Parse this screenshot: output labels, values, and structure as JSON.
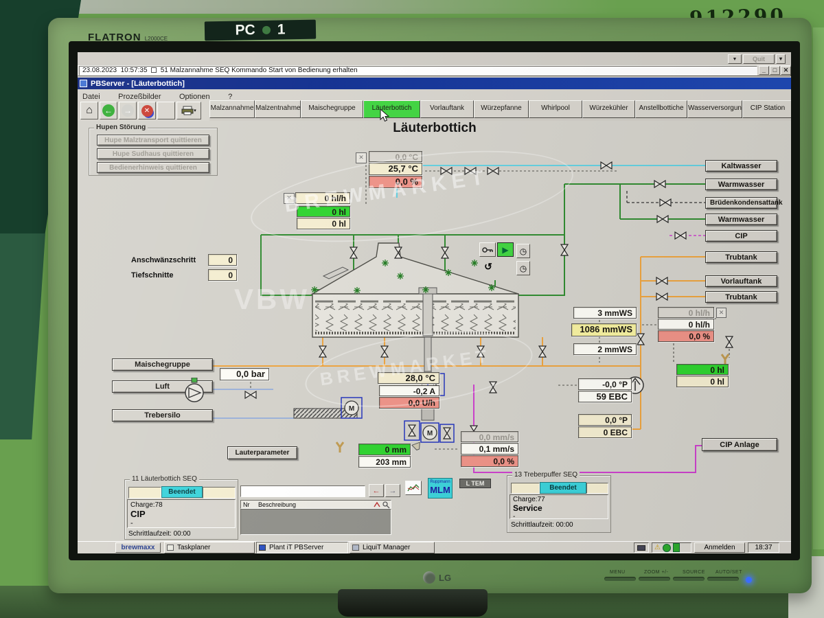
{
  "colors": {
    "active_tab_green": "#3fd43f",
    "status_cyan": "#3ad2da",
    "value_cream": "#f4edd0",
    "value_red": "#ee9287",
    "value_green": "#2ed32e",
    "value_yellow": "#f6f1a0",
    "titlebar_blue": "#0a2a8c",
    "pipe_green": "#2e8a2e",
    "pipe_orange": "#eda33d",
    "pipe_cyan": "#62cfe0",
    "pipe_magenta": "#cc3fcc"
  },
  "icons": {
    "down_arrow": "▼",
    "dropdown": "▾",
    "minimize": "_",
    "restore": "□",
    "close": "✕",
    "home": "⌂",
    "back": "←",
    "forward": "→",
    "play": "▶",
    "timer": "◷",
    "reset": "↺",
    "warning": "⚠",
    "arrow_left": "←",
    "arrow_right": "→",
    "motor": "M"
  },
  "photo": {
    "wall_number": "912290",
    "monitor_brand": "FLATRON",
    "monitor_model": "L2000CE",
    "sticker_pc": "PC",
    "sticker_no": "1",
    "lg_logo": "LG",
    "bezel_buttons": [
      "MENU",
      "ZOOM +/-",
      "SOURCE",
      "AUTO/SET"
    ]
  },
  "screen": {
    "quit_label": "Quit",
    "alarm": {
      "date": "23.08.2023",
      "time": "10:57:35",
      "message": "51 Malzannahme SEQ   Kommando Start von Bedienung erhalten"
    },
    "window_title": "PBServer - [Läuterbottich]",
    "menu": [
      "Datei",
      "Prozeßbilder",
      "Optionen",
      "?"
    ],
    "tabs": [
      {
        "label": "Malzannahme"
      },
      {
        "label": "Malzentnahme"
      },
      {
        "label": "Maischegruppe"
      },
      {
        "label": "Läuterbottich",
        "active": true
      },
      {
        "label": "Vorlauftank"
      },
      {
        "label": "Würzepfanne"
      },
      {
        "label": "Whirlpool"
      },
      {
        "label": "Würzekühler"
      },
      {
        "label": "Anstellbottiche"
      },
      {
        "label": "Wasserversorgung"
      },
      {
        "label": "CIP Station"
      }
    ],
    "canvas": {
      "title": "Läuterbottich",
      "hupen": {
        "title": "Hupen Störung",
        "buttons": [
          "Hupe Malztransport quittieren",
          "Hupe Sudhaus quittieren",
          "Bedienerhinweis quittieren"
        ]
      },
      "values": {
        "top_temp_alt": "0,0 °C",
        "top_temp": "25,7 °C",
        "top_pct": "0,0 %",
        "in_flow": "0 hl/h",
        "in_vol_set": "0 hl",
        "in_vol": "0 hl",
        "anschwaenz_label": "Anschwänzschritt",
        "anschwaenz": "0",
        "tiefschnitte_label": "Tiefschnitte",
        "tiefschnitte": "0",
        "pressure": "0,0 bar",
        "drive_temp": "28,0 °C",
        "drive_current": "-0,2 A",
        "drive_rate": "0,0 U/h",
        "diff_press_1": "3 mmWS",
        "diff_press_2": "1086 mmWS",
        "diff_press_3": "2 mmWS",
        "out_flow_alt": "0 hl/h",
        "out_flow": "0 hl/h",
        "out_pct": "0,0 %",
        "vol2_set": "0 hl",
        "vol2": "0 hl",
        "plato1": "-0,0 °P",
        "ebc1": "59 EBC",
        "plato2": "0,0 °P",
        "ebc2": "0 EBC",
        "speed_alt": "0,0 mm/s",
        "speed": "0,1 mm/s",
        "speed_pct": "0,0 %",
        "level_set": "0 mm",
        "level": "203 mm"
      },
      "left_buttons": [
        "Maischegruppe",
        "Luft",
        "Trebersilo"
      ],
      "lauterparameter_label": "Lauterparameter",
      "right_buttons": [
        "Kaltwasser",
        "Warmwasser",
        "Brüdenkondensattank",
        "Warmwasser",
        "CIP",
        "Trubtank",
        "Vorlauftank",
        "Trubtank"
      ],
      "cip_anlage_label": "CIP Anlage",
      "watermark": {
        "line1": "BREWMARKET",
        "line2": "VBW",
        "line3": "BREWMARKET"
      }
    },
    "seq1": {
      "title": "11 Läuterbottich SEQ",
      "status": "Beendet",
      "charge": "Charge:78",
      "mode": "CIP",
      "dash": "-",
      "runtime": "Schrittlaufzeit: 00:00"
    },
    "list_panel": {
      "col_nr": "Nr",
      "col_desc": "Beschreibung"
    },
    "mlm": {
      "vendor": "Ruppmann",
      "label": "MLM"
    },
    "ltem_label": "L TEM",
    "seq2": {
      "title": "13 Treberpuffer SEQ",
      "status": "Beendet",
      "charge": "Charge:77",
      "mode": "Service",
      "dash": "-",
      "runtime": "Schrittlaufzeit: 00:00"
    },
    "taskbar": {
      "start": "brewmaxx",
      "windows": [
        "Taskplaner",
        "Plant iT PBServer",
        "LiquiT Manager"
      ],
      "login": "Anmelden",
      "clock": "18:37"
    }
  }
}
